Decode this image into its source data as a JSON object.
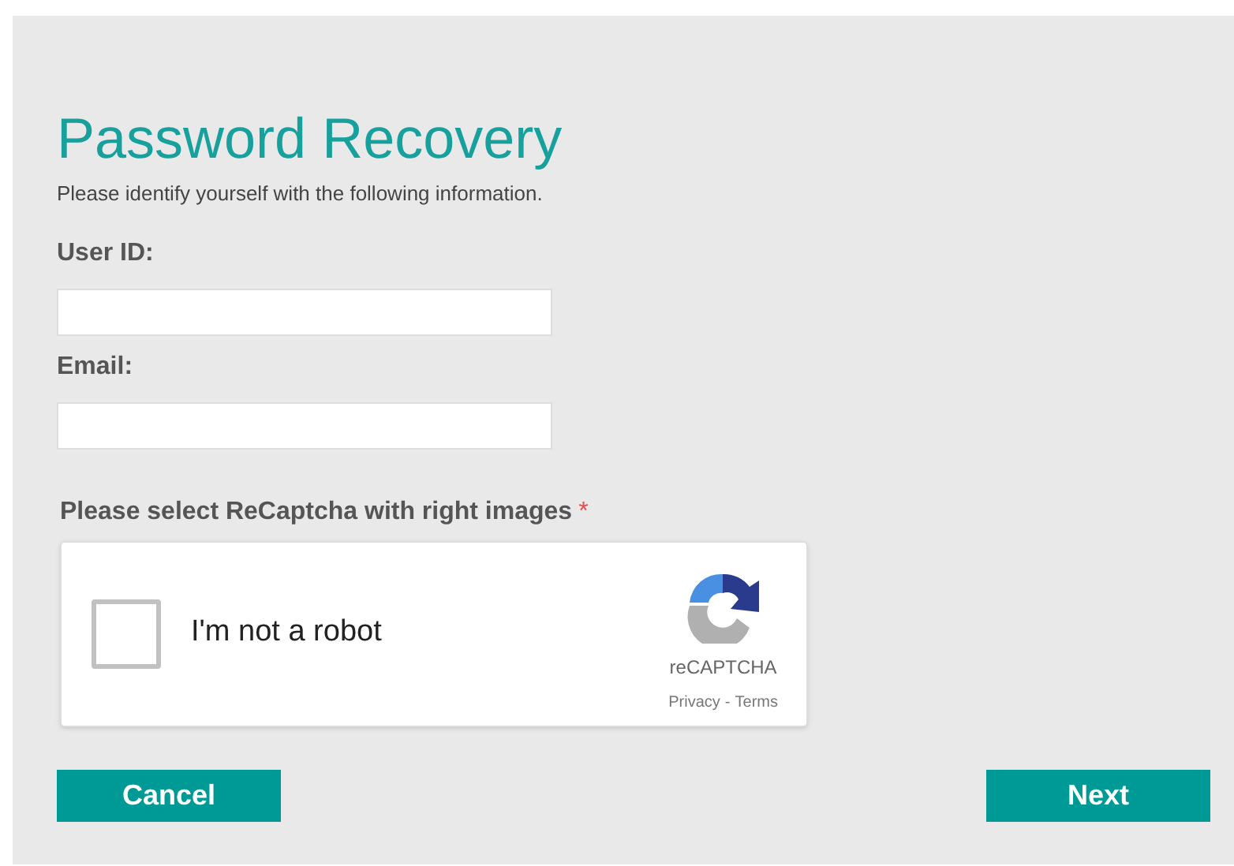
{
  "title": "Password Recovery",
  "instructions": "Please identify yourself with the following information.",
  "fields": [
    {
      "label": "User ID:"
    },
    {
      "label": "Email:"
    }
  ],
  "captcha": {
    "label": "Please select ReCaptcha with right images",
    "required_mark": "*",
    "checked": false,
    "checkbox_label": "I'm not a robot",
    "brand": "reCAPTCHA",
    "privacy": "Privacy",
    "separator": "-",
    "terms": "Terms"
  },
  "buttons": {
    "cancel": "Cancel",
    "next": "Next"
  }
}
